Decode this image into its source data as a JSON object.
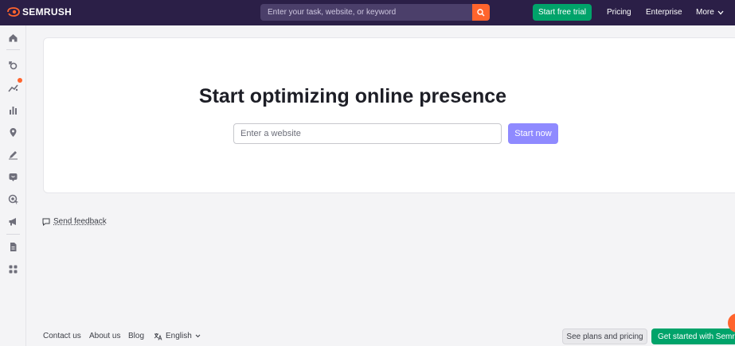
{
  "header": {
    "logo_text": "SEMRUSH",
    "search_placeholder": "Enter your task, website, or keyword",
    "trial_label": "Start free trial",
    "nav": [
      "Pricing",
      "Enterprise",
      "More"
    ]
  },
  "sidebar": {
    "icons": [
      "home-icon",
      "seo-icon",
      "traffic-icon",
      "local-icon",
      "pin-icon",
      "content-icon",
      "social-icon",
      "advertising-icon",
      "pr-icon",
      "report-icon",
      "apps-icon"
    ]
  },
  "main": {
    "headline": "Start optimizing online presence",
    "input_placeholder": "Enter a website",
    "start_label": "Start now",
    "feedback_label": "Send feedback"
  },
  "footer": {
    "contact": "Contact us",
    "about": "About us",
    "blog": "Blog",
    "language": "English",
    "plans_label": "See plans and pricing",
    "get_started_label": "Get started with Semrush"
  },
  "colors": {
    "header_bg": "#2b1f47",
    "accent_orange": "#ff642d",
    "green": "#00a36a",
    "start_button": "#8f8aff"
  }
}
